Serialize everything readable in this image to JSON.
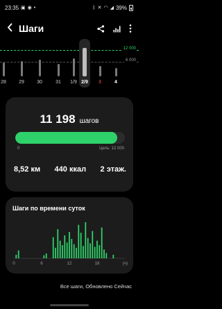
{
  "status_bar": {
    "time": "23:35",
    "notification_icons": [
      "image-notification-icon",
      "whatsapp-icon",
      "dot-icon"
    ],
    "system_icons": [
      "bluetooth-icon",
      "mute-icon",
      "wifi-icon",
      "signal-icon"
    ],
    "battery": "39%"
  },
  "header": {
    "title": "Шаги",
    "actions": [
      "share-icon",
      "trends-icon",
      "more-icon"
    ]
  },
  "week": {
    "goal_label": "12 000",
    "avg_label": "6 000",
    "days": [
      {
        "label": "28",
        "level": 0.45,
        "weekend": false,
        "selected": false,
        "today": false
      },
      {
        "label": "29",
        "level": 0.5,
        "weekend": false,
        "selected": false,
        "today": false
      },
      {
        "label": "30",
        "level": 0.55,
        "weekend": false,
        "selected": false,
        "today": false
      },
      {
        "label": "31",
        "level": 0.42,
        "weekend": false,
        "selected": false,
        "today": false
      },
      {
        "label": "1/9",
        "level": 0.6,
        "weekend": false,
        "selected": false,
        "today": false
      },
      {
        "label": "2/9",
        "level": 0.93,
        "weekend": false,
        "selected": true,
        "today": false
      },
      {
        "label": "3",
        "level": 0.35,
        "weekend": true,
        "selected": false,
        "today": false
      },
      {
        "label": "4",
        "level": 0.28,
        "weekend": false,
        "selected": false,
        "today": true
      }
    ]
  },
  "summary": {
    "steps": "11 198",
    "steps_unit": "шагов",
    "progress": 0.933,
    "min_label": "0",
    "goal_label": "Цель: 12 000",
    "distance": "8,52 км",
    "calories": "440 ккал",
    "floors": "2 этаж."
  },
  "hourly": {
    "title": "Шаги по времени суток",
    "unit_label": "(ч)",
    "tick_labels": [
      "0",
      "6",
      "12",
      "18"
    ]
  },
  "footer": {
    "note": "Все шаги, Обновлено Сейчас"
  },
  "colors": {
    "accent": "#2fd26a",
    "background": "#000000",
    "card": "#1c1c1c",
    "weekend": "#ff5a5a"
  },
  "chart_data": {
    "type": "bar",
    "title": "Шаги по времени суток",
    "xlabel": "(ч)",
    "ylabel": "",
    "x_ticks": [
      "0",
      "6",
      "12",
      "18"
    ],
    "xlim": [
      0,
      24
    ],
    "bin_hours": 0.25,
    "values": [
      0,
      0,
      0,
      0,
      0,
      0,
      0,
      0,
      0,
      0,
      0,
      0,
      0,
      0,
      0,
      0,
      0,
      0,
      0,
      0,
      0,
      0,
      0,
      0,
      0,
      0,
      0,
      0,
      0,
      0,
      0,
      0,
      0,
      0,
      0,
      0,
      0,
      0,
      0,
      0,
      0,
      0,
      0,
      0,
      0,
      0,
      0,
      0,
      0,
      0,
      0,
      0,
      0,
      0,
      0,
      0,
      0,
      0,
      0,
      0,
      0,
      0,
      0,
      0,
      0,
      0,
      0,
      0,
      0,
      0,
      0,
      0,
      0,
      0,
      0,
      0,
      0,
      0,
      0,
      0,
      0,
      0,
      0,
      0,
      0,
      0,
      0,
      0,
      0,
      0,
      0,
      0,
      0,
      0,
      0,
      0,
      0,
      0,
      0,
      0,
      0,
      0,
      0,
      0,
      0,
      0,
      0,
      0,
      0,
      0,
      0,
      0,
      0,
      0,
      0,
      0,
      0,
      0,
      0,
      0,
      0,
      0,
      0,
      0,
      0,
      0,
      0,
      0,
      0,
      0,
      0,
      0,
      0,
      0,
      0,
      0,
      0,
      0,
      0,
      0,
      0,
      0,
      0,
      0,
      0,
      0,
      0,
      0,
      0,
      0,
      0,
      0,
      0,
      0,
      0,
      0,
      0,
      0,
      0,
      0,
      0,
      0,
      0,
      0,
      0,
      0,
      0,
      0,
      0,
      0,
      0,
      0,
      0,
      0,
      0,
      0,
      0,
      0,
      0,
      0,
      0,
      0,
      0,
      0,
      0,
      0,
      0,
      0,
      0,
      0,
      0,
      0
    ],
    "bars": [
      {
        "hour": 0.5,
        "steps": 40
      },
      {
        "hour": 1.0,
        "steps": 90
      },
      {
        "hour": 6.5,
        "steps": 35
      },
      {
        "hour": 7.0,
        "steps": 55
      },
      {
        "hour": 8.5,
        "steps": 240
      },
      {
        "hour": 9.0,
        "steps": 120
      },
      {
        "hour": 9.5,
        "steps": 330
      },
      {
        "hour": 10.0,
        "steps": 200
      },
      {
        "hour": 10.5,
        "steps": 150
      },
      {
        "hour": 11.0,
        "steps": 260
      },
      {
        "hour": 11.5,
        "steps": 180
      },
      {
        "hour": 12.0,
        "steps": 300
      },
      {
        "hour": 12.5,
        "steps": 220
      },
      {
        "hour": 13.0,
        "steps": 160
      },
      {
        "hour": 13.5,
        "steps": 120
      },
      {
        "hour": 14.0,
        "steps": 380
      },
      {
        "hour": 14.5,
        "steps": 290
      },
      {
        "hour": 15.0,
        "steps": 140
      },
      {
        "hour": 15.5,
        "steps": 410
      },
      {
        "hour": 16.0,
        "steps": 230
      },
      {
        "hour": 16.5,
        "steps": 170
      },
      {
        "hour": 17.0,
        "steps": 310
      },
      {
        "hour": 17.5,
        "steps": 130
      },
      {
        "hour": 18.0,
        "steps": 200
      },
      {
        "hour": 18.5,
        "steps": 150
      },
      {
        "hour": 19.0,
        "steps": 350
      },
      {
        "hour": 19.5,
        "steps": 100
      },
      {
        "hour": 20.0,
        "steps": 60
      },
      {
        "hour": 21.5,
        "steps": 40
      }
    ]
  }
}
